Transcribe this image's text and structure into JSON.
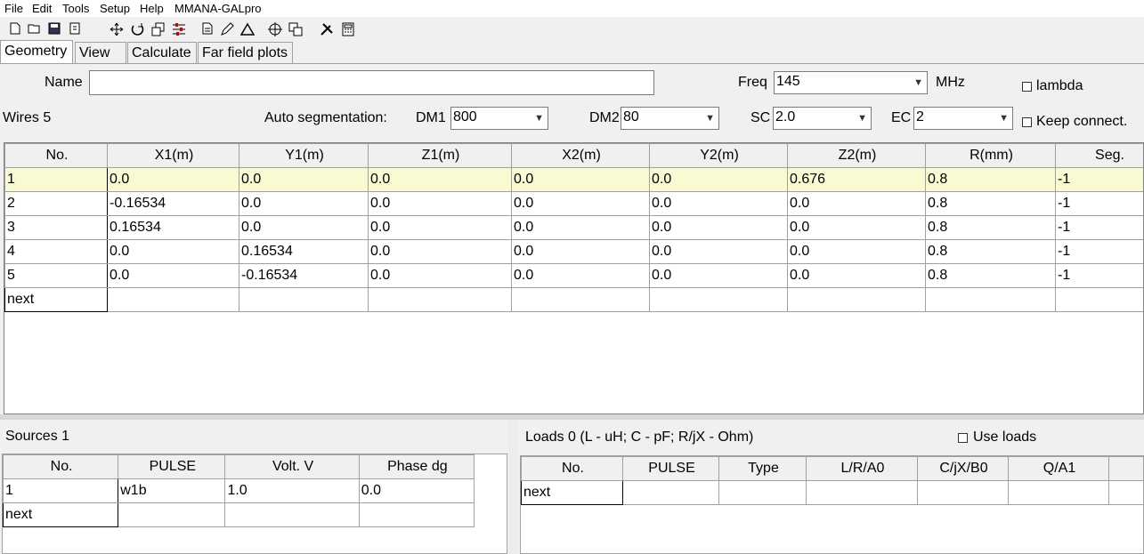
{
  "menu": [
    "File",
    "Edit",
    "Tools",
    "Setup",
    "Help",
    "MMANA-GALpro"
  ],
  "toolbar_icons": [
    "new-file-icon",
    "open-folder-icon",
    "save-icon",
    "properties-icon",
    "move-icon",
    "rotate-icon",
    "copy-icon",
    "adjust-icon",
    "document-icon",
    "edit-icon",
    "triangle-icon",
    "target-icon",
    "duplicate-icon",
    "tools-icon",
    "calculator-icon"
  ],
  "tabs": [
    "Geometry",
    "View",
    "Calculate",
    "Far field plots"
  ],
  "name_label": "Name",
  "name_value": "",
  "freq": {
    "label": "Freq",
    "value": "145",
    "unit": "MHz"
  },
  "lambda_label": "lambda",
  "wires_label": "Wires 5",
  "auto_seg_label": "Auto segmentation:",
  "dm1": {
    "label": "DM1",
    "value": "800"
  },
  "dm2": {
    "label": "DM2",
    "value": "80"
  },
  "sc": {
    "label": "SC",
    "value": "2.0"
  },
  "ec": {
    "label": "EC",
    "value": "2"
  },
  "keep_connect_label": "Keep connect.",
  "wires_table": {
    "headers": [
      "No.",
      "X1(m)",
      "Y1(m)",
      "Z1(m)",
      "X2(m)",
      "Y2(m)",
      "Z2(m)",
      "R(mm)",
      "Seg."
    ],
    "rows": [
      [
        "1",
        "0.0",
        "0.0",
        "0.0",
        "0.0",
        "0.0",
        "0.676",
        "0.8",
        "-1"
      ],
      [
        "2",
        "-0.16534",
        "0.0",
        "0.0",
        "0.0",
        "0.0",
        "0.0",
        "0.8",
        "-1"
      ],
      [
        "3",
        "0.16534",
        "0.0",
        "0.0",
        "0.0",
        "0.0",
        "0.0",
        "0.8",
        "-1"
      ],
      [
        "4",
        "0.0",
        "0.16534",
        "0.0",
        "0.0",
        "0.0",
        "0.0",
        "0.8",
        "-1"
      ],
      [
        "5",
        "0.0",
        "-0.16534",
        "0.0",
        "0.0",
        "0.0",
        "0.0",
        "0.8",
        "-1"
      ],
      [
        "next",
        "",
        "",
        "",
        "",
        "",
        "",
        "",
        ""
      ]
    ]
  },
  "sources_label": "Sources 1",
  "sources_table": {
    "headers": [
      "No.",
      "PULSE",
      "Volt. V",
      "Phase dg"
    ],
    "rows": [
      [
        "1",
        "w1b",
        "1.0",
        "0.0"
      ],
      [
        "next",
        "",
        "",
        ""
      ]
    ]
  },
  "loads_label": "Loads 0 (L - uH; C - pF; R/jX - Ohm)",
  "use_loads_label": "Use loads",
  "loads_table": {
    "headers": [
      "No.",
      "PULSE",
      "Type",
      "L/R/A0",
      "C/jX/B0",
      "Q/A1",
      ""
    ],
    "rows": [
      [
        "next",
        "",
        "",
        "",
        "",
        "",
        ""
      ]
    ]
  }
}
